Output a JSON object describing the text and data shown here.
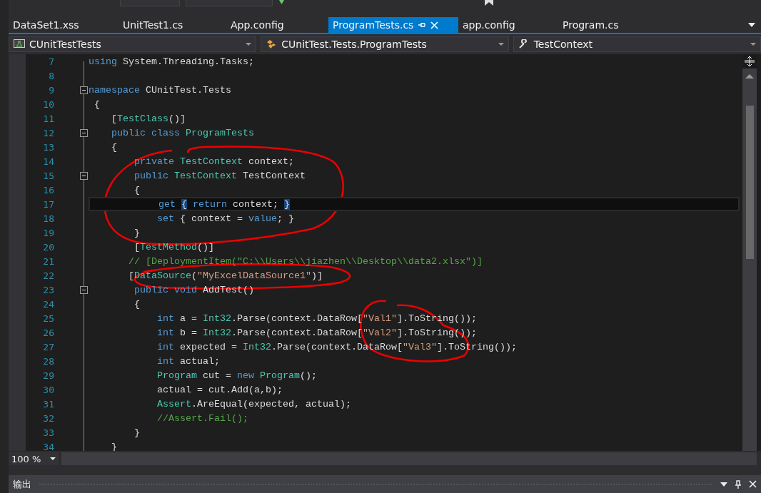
{
  "tabs": [
    {
      "label": "DataSet1.xss",
      "selected": false
    },
    {
      "label": "UnitTest1.cs",
      "selected": false
    },
    {
      "label": "App.config",
      "selected": false
    },
    {
      "label": "ProgramTests.cs",
      "selected": true
    },
    {
      "label": "app.config",
      "selected": false
    },
    {
      "label": "Program.cs",
      "selected": false
    }
  ],
  "navigation": [
    {
      "kind": "project",
      "label": "CUnitTestTests"
    },
    {
      "kind": "class",
      "label": "CUnitTest.Tests.ProgramTests"
    },
    {
      "kind": "member",
      "label": "TestContext"
    }
  ],
  "editor": {
    "lines": [
      {
        "number": "7",
        "collapsible": false,
        "current": false,
        "tokens": [
          {
            "kind": "keyword",
            "text": "using"
          },
          {
            "kind": "plain",
            "text": " System.Threading.Tasks;"
          }
        ]
      },
      {
        "number": "8",
        "collapsible": false,
        "current": false
      },
      {
        "number": "9",
        "collapsible": true,
        "current": false,
        "tokens": [
          {
            "kind": "keyword",
            "text": "namespace"
          },
          {
            "kind": "plain",
            "text": " CUnitTest.Tests"
          }
        ]
      },
      {
        "number": "10",
        "collapsible": false,
        "current": false,
        "tokens": [
          {
            "kind": "plain",
            "text": " {"
          }
        ]
      },
      {
        "number": "11",
        "collapsible": false,
        "current": false,
        "tokens": [
          {
            "kind": "plain",
            "text": "    ["
          },
          {
            "kind": "type",
            "text": "TestClass"
          },
          {
            "kind": "plain",
            "text": "()]"
          }
        ]
      },
      {
        "number": "12",
        "collapsible": true,
        "current": false,
        "tokens": [
          {
            "kind": "keyword",
            "text": "    public class"
          },
          {
            "kind": "type",
            "text": " ProgramTests"
          }
        ]
      },
      {
        "number": "13",
        "collapsible": false,
        "current": false,
        "tokens": [
          {
            "kind": "plain",
            "text": "    {"
          }
        ]
      },
      {
        "number": "14",
        "collapsible": false,
        "current": false,
        "tokens": [
          {
            "kind": "keyword",
            "text": "        private"
          },
          {
            "kind": "type",
            "text": " TestContext"
          },
          {
            "kind": "plain",
            "text": " context;"
          }
        ]
      },
      {
        "number": "15",
        "collapsible": true,
        "current": false,
        "tokens": [
          {
            "kind": "keyword",
            "text": "        public"
          },
          {
            "kind": "type",
            "text": " TestContext"
          },
          {
            "kind": "plain",
            "text": " TestContext"
          }
        ]
      },
      {
        "number": "16",
        "collapsible": false,
        "current": false,
        "tokens": [
          {
            "kind": "plain",
            "text": "        {"
          }
        ]
      },
      {
        "number": "17",
        "collapsible": false,
        "current": true,
        "tokens": [
          {
            "kind": "keyword",
            "text": "            get "
          },
          {
            "kind": "brace_match",
            "text": "{"
          },
          {
            "kind": "keyword",
            "text": " return"
          },
          {
            "kind": "plain",
            "text": " context; "
          },
          {
            "kind": "brace_match",
            "text": "}"
          }
        ]
      },
      {
        "number": "18",
        "collapsible": false,
        "current": false,
        "tokens": [
          {
            "kind": "keyword",
            "text": "            set"
          },
          {
            "kind": "plain",
            "text": " { context = "
          },
          {
            "kind": "keyword",
            "text": "value"
          },
          {
            "kind": "plain",
            "text": "; }"
          }
        ]
      },
      {
        "number": "19",
        "collapsible": false,
        "current": false,
        "tokens": [
          {
            "kind": "plain",
            "text": "        }"
          }
        ]
      },
      {
        "number": "20",
        "collapsible": false,
        "current": false,
        "tokens": [
          {
            "kind": "plain",
            "text": "        ["
          },
          {
            "kind": "type",
            "text": "TestMethod"
          },
          {
            "kind": "plain",
            "text": "()]"
          }
        ]
      },
      {
        "number": "21",
        "collapsible": false,
        "current": false,
        "tokens": [
          {
            "kind": "comment",
            "text": "       // [DeploymentItem(\"C:\\\\Users\\\\jiazhen\\\\Desktop\\\\data2.xlsx\")]"
          }
        ]
      },
      {
        "number": "22",
        "collapsible": false,
        "current": false,
        "tokens": [
          {
            "kind": "plain",
            "text": "       ["
          },
          {
            "kind": "type",
            "text": "DataSource"
          },
          {
            "kind": "plain",
            "text": "("
          },
          {
            "kind": "string",
            "text": "\"MyExcelDataSource1\""
          },
          {
            "kind": "plain",
            "text": ")]"
          }
        ]
      },
      {
        "number": "23",
        "collapsible": true,
        "current": false,
        "tokens": [
          {
            "kind": "keyword",
            "text": "        public void"
          },
          {
            "kind": "plain",
            "text": " AddTest()"
          }
        ]
      },
      {
        "number": "24",
        "collapsible": false,
        "current": false,
        "tokens": [
          {
            "kind": "plain",
            "text": "        {"
          }
        ]
      },
      {
        "number": "25",
        "collapsible": false,
        "current": false,
        "tokens": [
          {
            "kind": "keyword",
            "text": "            int"
          },
          {
            "kind": "plain",
            "text": " a = "
          },
          {
            "kind": "type",
            "text": "Int32"
          },
          {
            "kind": "plain",
            "text": ".Parse(context.DataRow["
          },
          {
            "kind": "string",
            "text": "\"Val1\""
          },
          {
            "kind": "plain",
            "text": "].ToString());"
          }
        ]
      },
      {
        "number": "26",
        "collapsible": false,
        "current": false,
        "tokens": [
          {
            "kind": "keyword",
            "text": "            int"
          },
          {
            "kind": "plain",
            "text": " b = "
          },
          {
            "kind": "type",
            "text": "Int32"
          },
          {
            "kind": "plain",
            "text": ".Parse(context.DataRow["
          },
          {
            "kind": "string",
            "text": "\"Val2\""
          },
          {
            "kind": "plain",
            "text": "].ToString());"
          }
        ]
      },
      {
        "number": "27",
        "collapsible": false,
        "current": false,
        "tokens": [
          {
            "kind": "keyword",
            "text": "            int"
          },
          {
            "kind": "plain",
            "text": " expected = "
          },
          {
            "kind": "type",
            "text": "Int32"
          },
          {
            "kind": "plain",
            "text": ".Parse(context.DataRow["
          },
          {
            "kind": "string",
            "text": "\"Val3\""
          },
          {
            "kind": "plain",
            "text": "].ToString());"
          }
        ]
      },
      {
        "number": "28",
        "collapsible": false,
        "current": false,
        "tokens": [
          {
            "kind": "keyword",
            "text": "            int"
          },
          {
            "kind": "plain",
            "text": " actual;"
          }
        ]
      },
      {
        "number": "29",
        "collapsible": false,
        "current": false,
        "tokens": [
          {
            "kind": "type",
            "text": "            Program"
          },
          {
            "kind": "plain",
            "text": " cut = "
          },
          {
            "kind": "keyword",
            "text": "new"
          },
          {
            "kind": "type",
            "text": " Program"
          },
          {
            "kind": "plain",
            "text": "();"
          }
        ]
      },
      {
        "number": "30",
        "collapsible": false,
        "current": false,
        "tokens": [
          {
            "kind": "plain",
            "text": "            actual = cut.Add(a,b);"
          }
        ]
      },
      {
        "number": "31",
        "collapsible": false,
        "current": false,
        "tokens": [
          {
            "kind": "type",
            "text": "            Assert"
          },
          {
            "kind": "plain",
            "text": ".AreEqual(expected, actual);"
          }
        ]
      },
      {
        "number": "32",
        "collapsible": false,
        "current": false,
        "tokens": [
          {
            "kind": "comment",
            "text": "            //Assert.Fail();"
          }
        ]
      },
      {
        "number": "33",
        "collapsible": false,
        "current": false,
        "tokens": [
          {
            "kind": "plain",
            "text": "        }"
          }
        ]
      },
      {
        "number": "34",
        "collapsible": false,
        "current": false,
        "tokens": [
          {
            "kind": "plain",
            "text": "    }"
          }
        ]
      }
    ]
  },
  "zoom": "100 %",
  "output_panel": {
    "title": "输出"
  }
}
